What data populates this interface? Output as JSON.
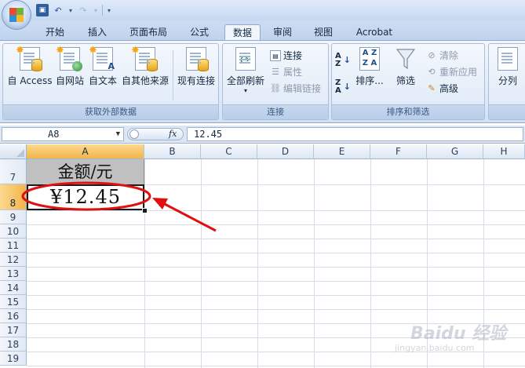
{
  "quick_access": {
    "save_icon": "save-icon",
    "undo_icon": "undo-icon",
    "redo_icon": "redo-icon"
  },
  "tabs": [
    {
      "label": "开始",
      "active": false
    },
    {
      "label": "插入",
      "active": false
    },
    {
      "label": "页面布局",
      "active": false
    },
    {
      "label": "公式",
      "active": false
    },
    {
      "label": "数据",
      "active": true
    },
    {
      "label": "审阅",
      "active": false
    },
    {
      "label": "视图",
      "active": false
    },
    {
      "label": "Acrobat",
      "active": false
    }
  ],
  "ribbon": {
    "external_data": {
      "label": "获取外部数据",
      "from_access": "自 Access",
      "from_web": "自网站",
      "from_text": "自文本",
      "from_other": "自其他来源",
      "existing": "现有连接"
    },
    "connections": {
      "label": "连接",
      "refresh_all": "全部刷新",
      "connections": "连接",
      "properties": "属性",
      "edit_links": "编辑链接"
    },
    "sort_filter": {
      "label": "排序和筛选",
      "sort_az": "A Z",
      "sort": "排序...",
      "filter": "筛选",
      "clear": "清除",
      "reapply": "重新应用",
      "advanced": "高级"
    },
    "tools": {
      "split": "分列"
    }
  },
  "formula_bar": {
    "name_box": "A8",
    "fx": "fx",
    "value": "12.45"
  },
  "sheet": {
    "columns": [
      "A",
      "B",
      "C",
      "D",
      "E",
      "F",
      "G",
      "H"
    ],
    "selected_column": "A",
    "rows": [
      "7",
      "8",
      "9",
      "10",
      "11",
      "12",
      "13",
      "14",
      "15",
      "16",
      "17",
      "18",
      "19"
    ],
    "selected_row": "8",
    "cells": {
      "A7": "金额/元",
      "A8": "¥12.45"
    },
    "header_fill": "#c0c0c0",
    "annotation_color": "#e01010"
  },
  "watermark": {
    "main": "Baidu 经验",
    "sub": "jingyan.baidu.com"
  }
}
